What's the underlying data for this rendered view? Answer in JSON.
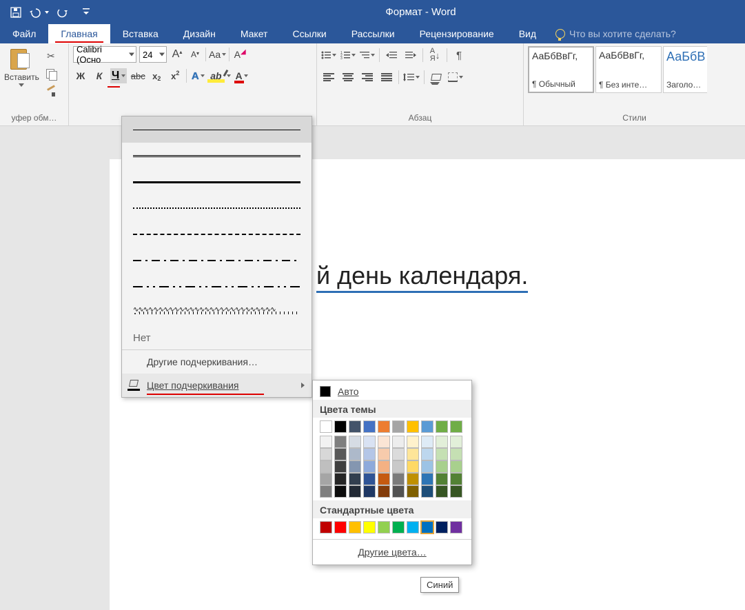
{
  "title": "Формат - Word",
  "tabs": {
    "file": "Файл",
    "home": "Главная",
    "insert": "Вставка",
    "design": "Дизайн",
    "layout": "Макет",
    "references": "Ссылки",
    "mailings": "Рассылки",
    "review": "Рецензирование",
    "view": "Вид"
  },
  "tell_me": "Что вы хотите сделать?",
  "clipboard": {
    "paste": "Вставить",
    "group": "уфер обм…"
  },
  "font": {
    "name": "Calibri (Осно",
    "size": "24",
    "bold": "Ж",
    "italic": "К",
    "underline": "Ч",
    "strike": "abc",
    "sub_base": "x",
    "sup_base": "x",
    "effects": "A",
    "highlight": "ab",
    "color": "A",
    "grow": "A",
    "shrink": "A",
    "case": "Aa",
    "clear": "A"
  },
  "paragraph": {
    "group": "Абзац",
    "pilcrow": "¶",
    "sort": "А↓\nЯ"
  },
  "styles": {
    "group": "Стили",
    "sample": "АаБбВвГг,",
    "sample_big": "АаБбВ",
    "normal_prefix": "¶ ",
    "normal": "Обычный",
    "no_spacing_prefix": "¶ ",
    "no_spacing": "Без инте…",
    "heading1": "Заголово…"
  },
  "doc_text": "й день календаря.",
  "underline_menu": {
    "none": "Нет",
    "more": "Другие подчеркивания…",
    "color": "Цвет подчеркивания"
  },
  "color_menu": {
    "auto": "Авто",
    "theme_heading": "Цвета темы",
    "theme_row0": [
      "#ffffff",
      "#000000",
      "#44546a",
      "#4472c4",
      "#ed7d31",
      "#a5a5a5",
      "#ffc000",
      "#5b9bd5",
      "#70ad47",
      "#70ad47"
    ],
    "theme_shades": [
      [
        "#f2f2f2",
        "#7f7f7f",
        "#d6dce4",
        "#d9e2f3",
        "#fbe5d5",
        "#ededed",
        "#fff2cc",
        "#deebf6",
        "#e2efd9",
        "#e2efd9"
      ],
      [
        "#d8d8d8",
        "#595959",
        "#adb9ca",
        "#b4c6e7",
        "#f7cbac",
        "#dbdbdb",
        "#fee599",
        "#bdd7ee",
        "#c5e0b3",
        "#c5e0b3"
      ],
      [
        "#bfbfbf",
        "#3f3f3f",
        "#8496b0",
        "#8eaadb",
        "#f4b183",
        "#c9c9c9",
        "#ffd965",
        "#9cc3e5",
        "#a8d08d",
        "#a8d08d"
      ],
      [
        "#a5a5a5",
        "#262626",
        "#323f4f",
        "#2f5496",
        "#c55a11",
        "#7b7b7b",
        "#bf9000",
        "#2e75b5",
        "#538135",
        "#538135"
      ],
      [
        "#7f7f7f",
        "#0c0c0c",
        "#222a35",
        "#1f3864",
        "#833c0b",
        "#525252",
        "#7f6000",
        "#1e4e79",
        "#375623",
        "#375623"
      ]
    ],
    "standard_heading": "Стандартные цвета",
    "standard": [
      "#c00000",
      "#ff0000",
      "#ffc000",
      "#ffff00",
      "#92d050",
      "#00b050",
      "#00b0f0",
      "#0070c0",
      "#002060",
      "#7030a0"
    ],
    "selected_standard_index": 7,
    "more": "Другие цвета…",
    "tooltip": "Синий"
  }
}
